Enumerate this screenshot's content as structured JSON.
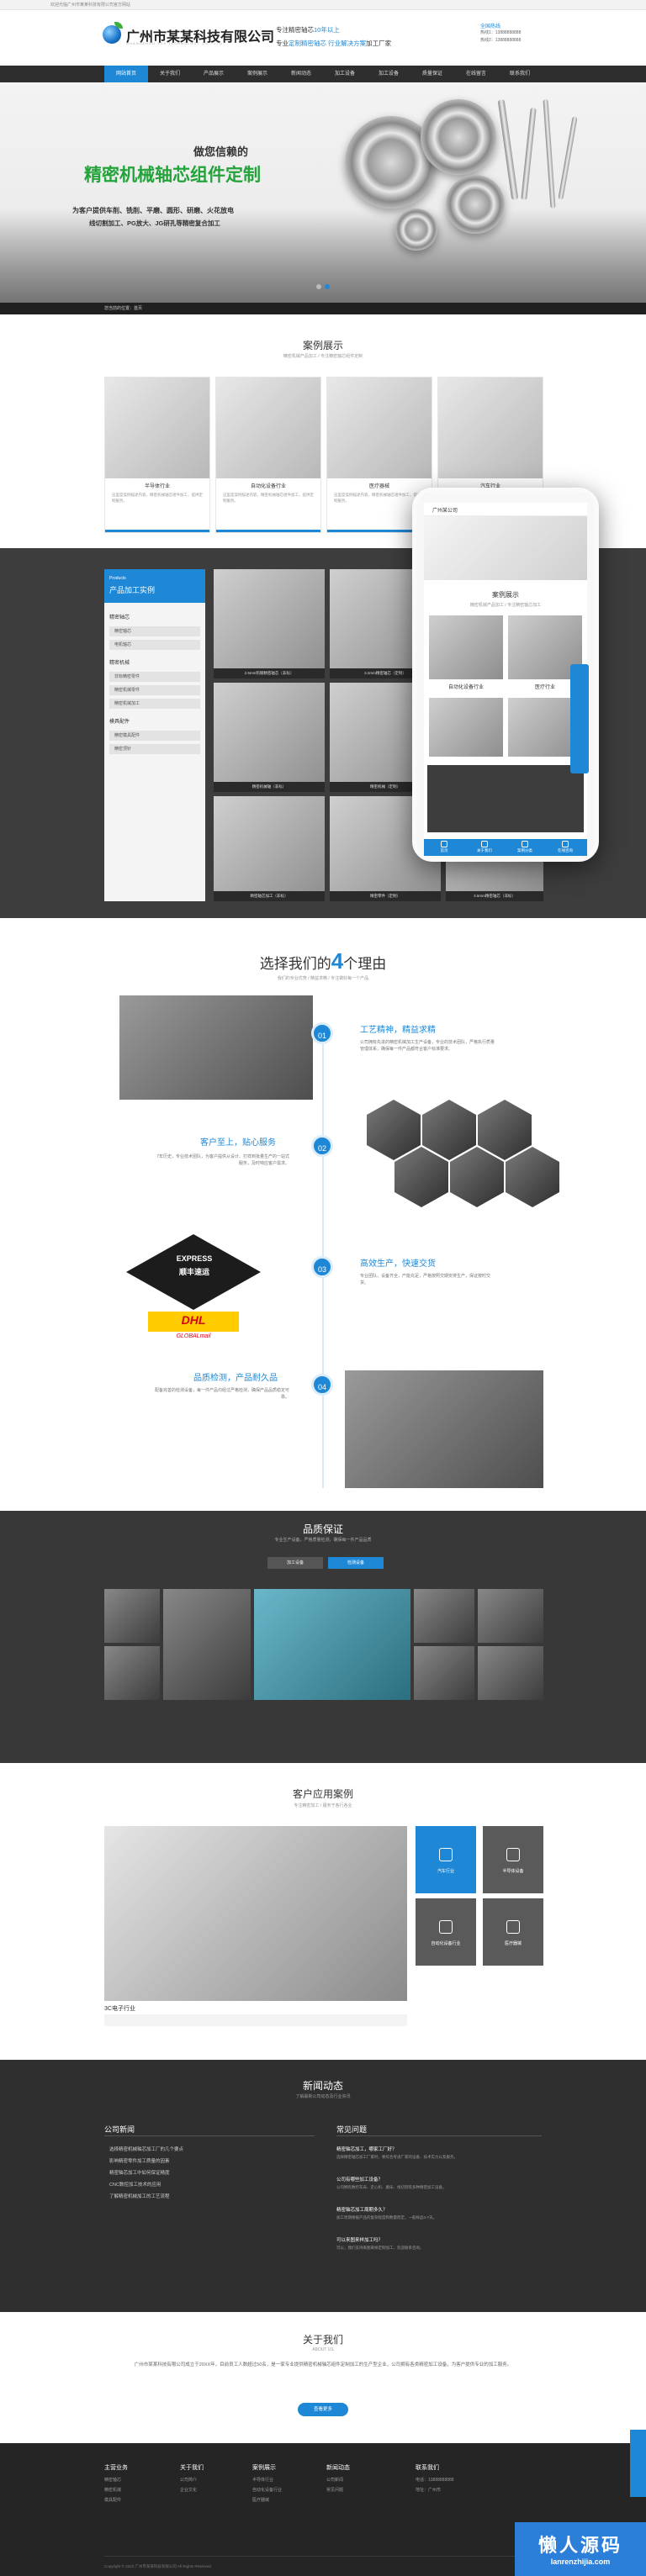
{
  "topbar": {
    "text": "欢迎光临广州市某某科技有限公司官方网站"
  },
  "header": {
    "company": "广州市某某科技有限公司",
    "company_en": "GUANGZHOU XXX TECHNOLOGY CO., LTD",
    "slogan_line1_prefix": "专注精密轴芯",
    "slogan_line1_highlight": "10年以上",
    "slogan_line2_prefix": "专业",
    "slogan_line2_highlight": "定制精密轴芯 行业解决方案",
    "slogan_line2_suffix": "加工厂家",
    "hotline_title": "全国热线",
    "hotline_1": "热线1：13888888888",
    "hotline_2": "热线2：13888888888"
  },
  "nav": [
    "网站首页",
    "关于我们",
    "产品展示",
    "案例展示",
    "新闻动态",
    "加工设备",
    "加工设备",
    "质量保证",
    "在线留言",
    "联系我们"
  ],
  "banner": {
    "sub": "做您信赖的",
    "title": "精密机械轴芯组件定制",
    "line1": "为客户提供车削、铣削、平磨、圆形、研磨、火花放电",
    "line2": "线切割加工、PG放大、JG研孔等精密复合加工"
  },
  "breadcrumb": "您当前的位置：首页",
  "cases": {
    "title": "案例展示",
    "sub": "精密机械产品加工 / 专注精密轴芯组件定制",
    "items": [
      {
        "title": "半导体行业",
        "desc": "这里是案例描述内容，精密机械轴芯组件加工，提供定制服务。"
      },
      {
        "title": "自动化设备行业",
        "desc": "这里是案例描述内容，精密机械轴芯组件加工，提供定制服务。"
      },
      {
        "title": "医疗器械",
        "desc": "这里是案例描述内容，精密机械轴芯组件加工，提供定制服务。"
      },
      {
        "title": "汽车行业",
        "desc": "这里是案例描述内容，精密机械轴芯组件加工，提供定制服务。"
      }
    ]
  },
  "products": {
    "side_en": "Products",
    "side_title": "产品加工实例",
    "categories": [
      {
        "name": "精密轴芯",
        "subs": [
          "精密轴芯",
          "电机轴芯"
        ]
      },
      {
        "name": "精密机械",
        "subs": [
          "非标精密零件",
          "精密机械零件",
          "精密机械加工"
        ]
      },
      {
        "name": "模具配件",
        "subs": [
          "精密模具配件",
          "精密顶针"
        ]
      }
    ],
    "items": [
      "2.5mm钨钢精密轴芯（非标）",
      "3.2mm精密轴芯（定制）",
      "精密机械轴（非标）",
      "精密机械（定制）",
      "精密轴芯加工（非标）",
      "精密零件（定制）",
      "精密机械配件（非标）",
      "3.1mm精密加工（非标）",
      "3.1mm钨钢精密加工（非标）",
      "3.5mm精密轴芯（非标）"
    ]
  },
  "phone": {
    "brand": "广州某公司",
    "section": "案例展示",
    "section_sub": "精密机械产品加工 / 专注精密轴芯加工",
    "case1": "自动化设备行业",
    "case2": "医疗行业",
    "bottom": [
      "首页",
      "关于我们",
      "案例分类",
      "在线咨询"
    ]
  },
  "reasons": {
    "title_prefix": "选择我们的",
    "title_num": "4",
    "title_suffix": "个理由",
    "sub": "我们的专业优势 / 精益求精 / 专注做好每一个产品",
    "items": [
      {
        "num": "01",
        "head": "工艺精神，精益求精",
        "text": "公司拥有先进的精密机械加工生产设备，专业的技术团队，严格执行质量管理体系，确保每一件产品都符合客户标准要求。"
      },
      {
        "num": "02",
        "head": "客户至上，贴心服务",
        "text": "7年历史，专业技术团队，为客户提供从设计、打样到批量生产的一站式服务，及时响应客户需求。"
      },
      {
        "num": "03",
        "head": "高效生产，快速交货",
        "text": "专业团队，设备齐全，产能充足，严格按照交期安排生产，保证按时交货。"
      },
      {
        "num": "04",
        "head": "品质检测，产品耐久品",
        "text": "配备完善的检测设备，每一件产品均经过严格检测，确保产品品质稳定可靠。"
      }
    ],
    "express": "EXPRESS",
    "express_cn": "顺丰速运",
    "dhl": "DHL",
    "global_mail": "GLOBALmail"
  },
  "quality": {
    "title": "品质保证",
    "sub": "专业生产设备，严格质量检测，确保每一件产品品质",
    "btn1": "加工设备",
    "btn2": "检测设备"
  },
  "apps": {
    "title": "客户应用案例",
    "sub": "专注精密加工 / 服务于各行各业",
    "caption": "3C电子行业",
    "tiles": [
      "汽车行业",
      "半导体设备",
      "自动化设备行业",
      "医疗器械"
    ]
  },
  "news": {
    "title": "新闻动态",
    "sub": "了解最新公司动态及行业资讯",
    "tab1": "公司新闻",
    "tab2": "常见问题",
    "list": [
      "选择精密机械轴芯加工厂的几个要点",
      "影响精密零件加工质量的因素",
      "精密轴芯加工中如何保证精度",
      "CNC数控加工技术的应用",
      "了解精密机械加工的工艺流程"
    ],
    "qa": [
      {
        "q": "精密轴芯加工，哪家工厂好？",
        "a": "选择精密轴芯加工厂家时，要综合考虑厂家的设备、技术实力以及服务。"
      },
      {
        "q": "公司有哪些加工设备？",
        "a": "公司拥有数控车床、走心机、磨床、线切割等多种精密加工设备。"
      },
      {
        "q": "精密轴芯加工周期多久？",
        "a": "加工周期根据产品的复杂程度和数量而定，一般样品3-7天。"
      },
      {
        "q": "可以来图来样加工吗？",
        "a": "可以，我们支持来图来样定制加工，欢迎联系咨询。"
      }
    ]
  },
  "about": {
    "title": "关于我们",
    "sub": "ABOUT US",
    "text": "广州市某某科技有限公司成立于20XX年，目前员工人数超过50名，是一家专业提供精密机械轴芯组件定制加工的生产型企业，公司拥有各类精密加工设备，为客户提供专业的加工服务。",
    "more": "查看更多"
  },
  "footer": {
    "cols": [
      {
        "h": "主营业务",
        "items": [
          "精密轴芯",
          "精密机械",
          "模具配件"
        ]
      },
      {
        "h": "关于我们",
        "items": [
          "公司简介",
          "企业文化"
        ]
      },
      {
        "h": "案例展示",
        "items": [
          "半导体行业",
          "自动化设备行业",
          "医疗器械"
        ]
      },
      {
        "h": "新闻动态",
        "items": [
          "公司新闻",
          "常见问题"
        ]
      },
      {
        "h": "联系我们",
        "items": [
          "电话：13888888888",
          "地址：广州市"
        ]
      }
    ],
    "copyright": "Copyright © 2022 广州市某某科技有限公司 All Rights Reserved."
  },
  "watermark": {
    "cn": "懒人源码",
    "url": "lanrenzhijia.com"
  }
}
